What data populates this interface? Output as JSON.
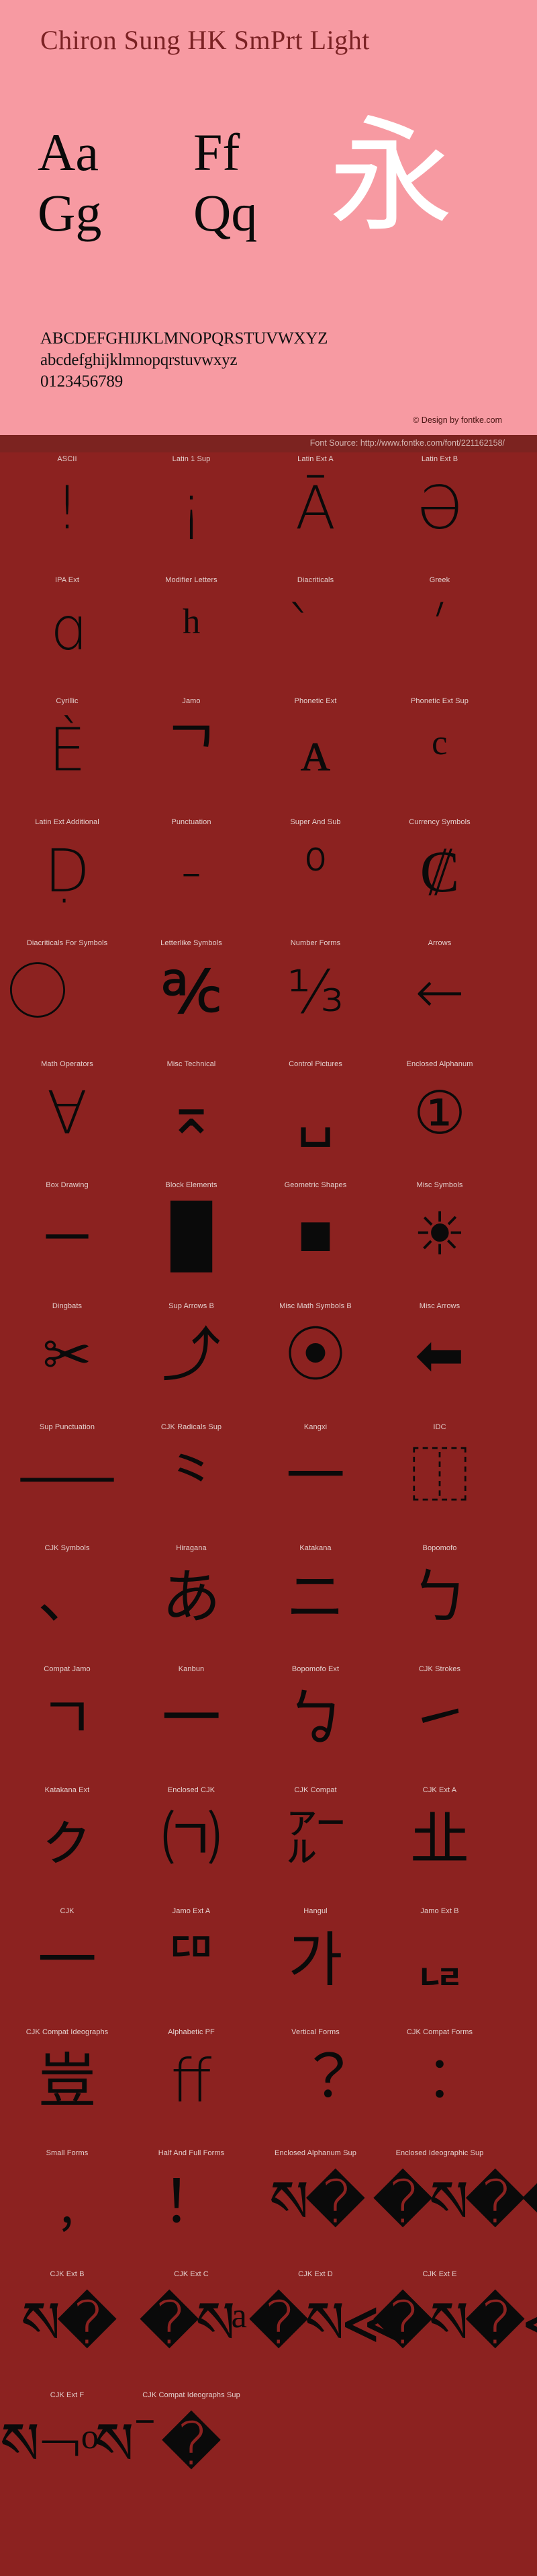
{
  "specimen": {
    "font_title": "Chiron Sung HK SmPrt Light",
    "big_glyphs": {
      "aa": "Aa",
      "ff": "Ff",
      "gg": "Gg",
      "qq": "Qq",
      "cjk": "永"
    },
    "uppercase": "ABCDEFGHIJKLMNOPQRSTUVWXYZ",
    "lowercase": "abcdefghijklmnopqrstuvwxyz",
    "digits": "0123456789",
    "design_credit": "© Design by fontke.com",
    "source_text": "Font Source: http://www.fontke.com/font/221162158/",
    "colors": {
      "panel_bg": "#f79aa2",
      "page_bg": "#8c2220",
      "title": "#7b2224",
      "source_bar": "#7c2320",
      "label": "#e3cfcc",
      "glyph": "#0a0a0a",
      "cjk_glyph": "#ffffff"
    }
  },
  "blocks": [
    {
      "label": "ASCII",
      "sample": "!"
    },
    {
      "label": "Latin 1 Sup",
      "sample": "¡"
    },
    {
      "label": "Latin Ext A",
      "sample": "Ā"
    },
    {
      "label": "Latin Ext B",
      "sample": "Ə"
    },
    {
      "label": "IPA Ext",
      "sample": "ɑ"
    },
    {
      "label": "Modifier Letters",
      "sample": "ʰ"
    },
    {
      "label": "Diacriticals",
      "sample": "̀"
    },
    {
      "label": "Greek",
      "sample": "ʹ"
    },
    {
      "label": "Cyrillic",
      "sample": "Ѐ"
    },
    {
      "label": "Jamo",
      "sample": "ᄀ"
    },
    {
      "label": "Phonetic Ext",
      "sample": "ᴀ"
    },
    {
      "label": "Phonetic Ext Sup",
      "sample": "ᶜ"
    },
    {
      "label": "Latin Ext Additional",
      "sample": "Ḍ"
    },
    {
      "label": "Punctuation",
      "sample": "‐"
    },
    {
      "label": "Super And Sub",
      "sample": "⁰"
    },
    {
      "label": "Currency Symbols",
      "sample": "₡"
    },
    {
      "label": "Diacriticals For Symbols",
      "sample": "⃝"
    },
    {
      "label": "Letterlike Symbols",
      "sample": "℀"
    },
    {
      "label": "Number Forms",
      "sample": "⅓"
    },
    {
      "label": "Arrows",
      "sample": "←"
    },
    {
      "label": "Math Operators",
      "sample": "∀"
    },
    {
      "label": "Misc Technical",
      "sample": "⌅"
    },
    {
      "label": "Control Pictures",
      "sample": "␣"
    },
    {
      "label": "Enclosed Alphanum",
      "sample": "①"
    },
    {
      "label": "Box Drawing",
      "sample": "─"
    },
    {
      "label": "Block Elements",
      "sample": "█"
    },
    {
      "label": "Geometric Shapes",
      "sample": "■"
    },
    {
      "label": "Misc Symbols",
      "sample": "☀"
    },
    {
      "label": "Dingbats",
      "sample": "✂"
    },
    {
      "label": "Sup Arrows B",
      "sample": "⤴"
    },
    {
      "label": "Misc Math Symbols B",
      "sample": "⦿"
    },
    {
      "label": "Misc Arrows",
      "sample": "⬅"
    },
    {
      "label": "Sup Punctuation",
      "sample": "⸺"
    },
    {
      "label": "CJK Radicals Sup",
      "sample": "⺀"
    },
    {
      "label": "Kangxi",
      "sample": "⼀"
    },
    {
      "label": "IDC",
      "sample": "⿰"
    },
    {
      "label": "CJK Symbols",
      "sample": "、"
    },
    {
      "label": "Hiragana",
      "sample": "あ"
    },
    {
      "label": "Katakana",
      "sample": "ニ"
    },
    {
      "label": "Bopomofo",
      "sample": "ㄅ"
    },
    {
      "label": "Compat Jamo",
      "sample": "ㄱ"
    },
    {
      "label": "Kanbun",
      "sample": "㆒"
    },
    {
      "label": "Bopomofo Ext",
      "sample": "ㆠ"
    },
    {
      "label": "CJK Strokes",
      "sample": "㇀"
    },
    {
      "label": "Katakana Ext",
      "sample": "ㇰ"
    },
    {
      "label": "Enclosed CJK",
      "sample": "㈀"
    },
    {
      "label": "CJK Compat",
      "sample": "㌃"
    },
    {
      "label": "CJK Ext A",
      "sample": "㐀"
    },
    {
      "label": "CJK",
      "sample": "一"
    },
    {
      "label": "Jamo Ext A",
      "sample": "ꥠ"
    },
    {
      "label": "Hangul",
      "sample": "가"
    },
    {
      "label": "Jamo Ext B",
      "sample": "ퟋ"
    },
    {
      "label": "CJK Compat Ideographs",
      "sample": "豈"
    },
    {
      "label": "Alphabetic PF",
      "sample": "ﬀ"
    },
    {
      "label": "Vertical Forms",
      "sample": "︖"
    },
    {
      "label": "CJK Compat Forms",
      "sample": "︰"
    },
    {
      "label": "Small Forms",
      "sample": "﹐"
    },
    {
      "label": "Half And Full Forms",
      "sample": "！"
    },
    {
      "label": "Enclosed Alphanum Sup",
      "sample": "ས�"
    },
    {
      "label": "Enclosed Ideographic Sup",
      "sample": "�ས��"
    },
    {
      "label": "CJK Ext B",
      "sample": "ས�"
    },
    {
      "label": "CJK Ext C",
      "sample": "�སᵃ"
    },
    {
      "label": "CJK Ext D",
      "sample": "�ས≪"
    },
    {
      "label": "CJK Ext E",
      "sample": "�ས�≪"
    },
    {
      "label": "CJK Ext F",
      "sample": "ས¬ᵒས¯"
    },
    {
      "label": "CJK Compat Ideographs Sup",
      "sample": "�"
    }
  ]
}
